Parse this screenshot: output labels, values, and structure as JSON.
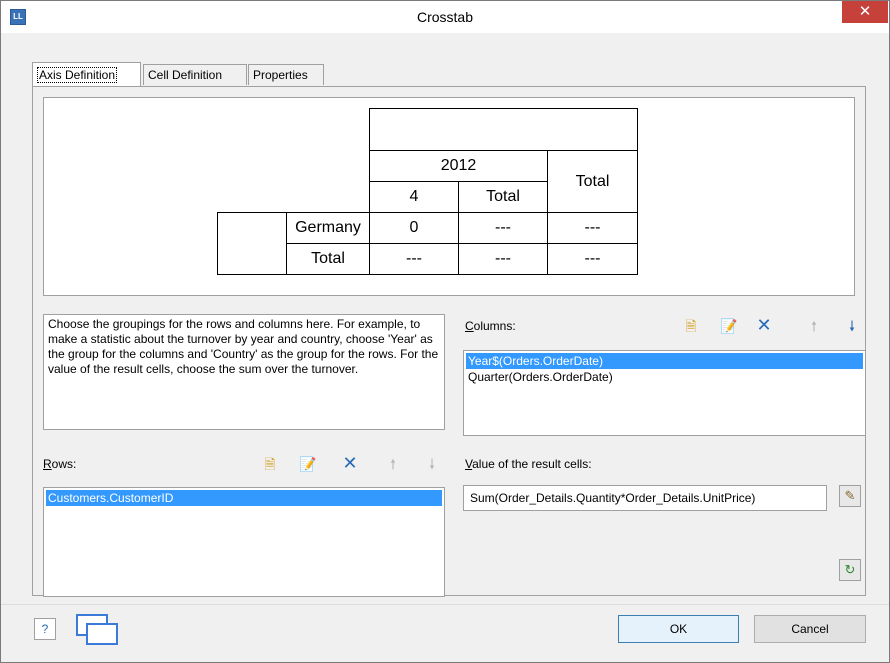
{
  "window": {
    "title": "Crosstab",
    "app_icon": "LL",
    "close_glyph": "✕"
  },
  "tabs": [
    {
      "label": "Axis Definition",
      "active": true
    },
    {
      "label": "Cell Definition",
      "active": false
    },
    {
      "label": "Properties",
      "active": false
    }
  ],
  "preview": {
    "year": "2012",
    "total_col": "Total",
    "quarter": "4",
    "quarter_total": "Total",
    "row_label": "Germany",
    "row_total": "Total",
    "cell_value": "0",
    "dashes": "---"
  },
  "description": "Choose the groupings for the rows and columns here. For example, to make a statistic about the turnover by year and country, choose 'Year' as the group for the columns and 'Country' as the group for the rows. For the value of the result cells, choose the sum over the turnover.",
  "columns": {
    "label_u": "C",
    "label_rest": "olumns:",
    "items": [
      "Year$(Orders.OrderDate)",
      "Quarter(Orders.OrderDate)"
    ]
  },
  "rows": {
    "label_u": "R",
    "label_rest": "ows:",
    "items": [
      "Customers.CustomerID"
    ]
  },
  "value": {
    "label_u": "V",
    "label_rest": "alue of the result cells:",
    "expression": "Sum(Order_Details.Quantity*Order_Details.UnitPrice)"
  },
  "buttons": {
    "ok": "OK",
    "cancel": "Cancel",
    "help": "?"
  }
}
